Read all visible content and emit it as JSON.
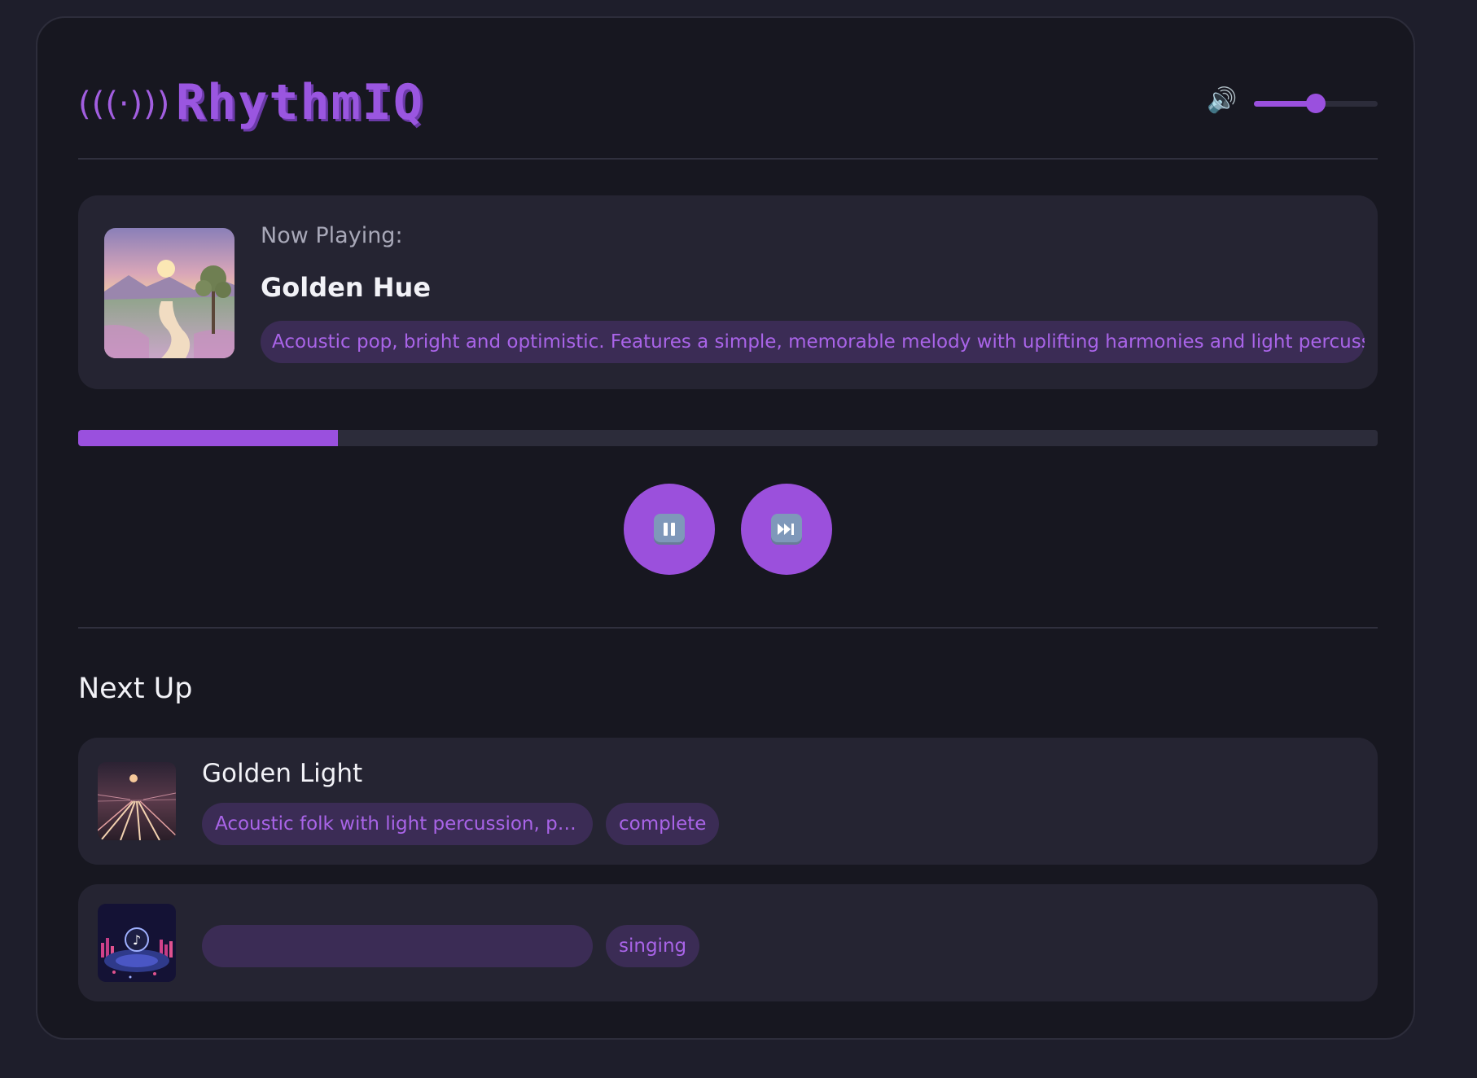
{
  "app": {
    "logo_icon": "(((·)))",
    "name": "RhythmIQ",
    "volume_icon": "speaker-icon",
    "volume_glyph": "🔊",
    "volume_level": 0.5
  },
  "now_playing": {
    "label": "Now Playing:",
    "title": "Golden Hue",
    "description": "Acoustic pop, bright and optimistic. Features a simple, memorable melody with uplifting harmonies and light percussion.",
    "progress": 0.2
  },
  "controls": {
    "pause_icon": "pause-icon",
    "skip_icon": "skip-forward-icon"
  },
  "next_up": {
    "heading": "Next Up",
    "items": [
      {
        "title": "Golden Light",
        "description": "Acoustic folk with light percussion, pure vocals, building to a warm chorus",
        "status": "complete"
      },
      {
        "title": "",
        "description": "",
        "status": "singing"
      }
    ]
  },
  "colors": {
    "accent": "#9a50de",
    "background": "#171720",
    "panel": "#252432",
    "pill_bg": "#3b2c55",
    "pill_text": "#a964e8"
  }
}
